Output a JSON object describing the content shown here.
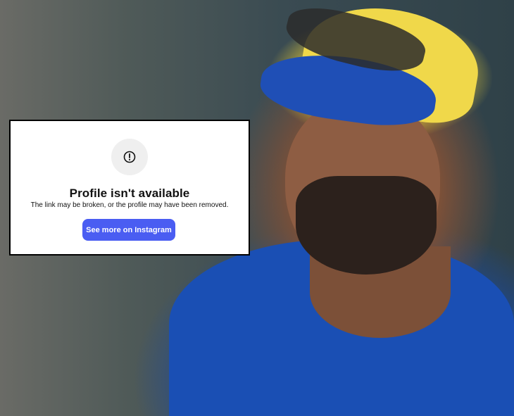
{
  "profile_error": {
    "title": "Profile isn't available",
    "message": "The link may be broken, or the profile may have been removed.",
    "button_label": "See more on Instagram",
    "icon": "alert-circle-icon"
  },
  "colors": {
    "button_bg": "#4a5df2",
    "button_text": "#ffffff",
    "frame_border": "#000000",
    "icon_circle_bg": "#efefef"
  }
}
